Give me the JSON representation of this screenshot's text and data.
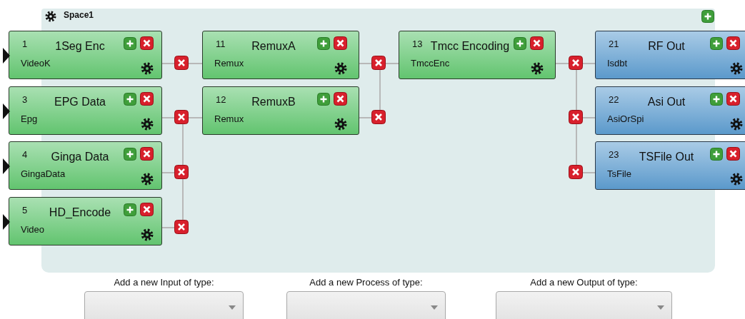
{
  "space": {
    "title": "Space1"
  },
  "inputs": [
    {
      "number": "1",
      "title": "1Seg Enc",
      "type": "VideoK"
    },
    {
      "number": "3",
      "title": "EPG Data",
      "type": "Epg"
    },
    {
      "number": "4",
      "title": "Ginga Data",
      "type": "GingaData"
    },
    {
      "number": "5",
      "title": "HD_Encode",
      "type": "Video"
    }
  ],
  "processes": [
    {
      "number": "11",
      "title": "RemuxA",
      "type": "Remux"
    },
    {
      "number": "12",
      "title": "RemuxB",
      "type": "Remux"
    },
    {
      "number": "13",
      "title": "Tmcc Encoding",
      "type": "TmccEnc"
    }
  ],
  "outputs": [
    {
      "number": "21",
      "title": "RF Out",
      "type": "Isdbt"
    },
    {
      "number": "22",
      "title": "Asi Out",
      "type": "AsiOrSpi"
    },
    {
      "number": "23",
      "title": "TSFile Out",
      "type": "TsFile"
    }
  ],
  "dropdowns": [
    {
      "label": "Add a new Input of type:"
    },
    {
      "label": "Add a new Process of type:"
    },
    {
      "label": "Add a new Output of type:"
    }
  ]
}
